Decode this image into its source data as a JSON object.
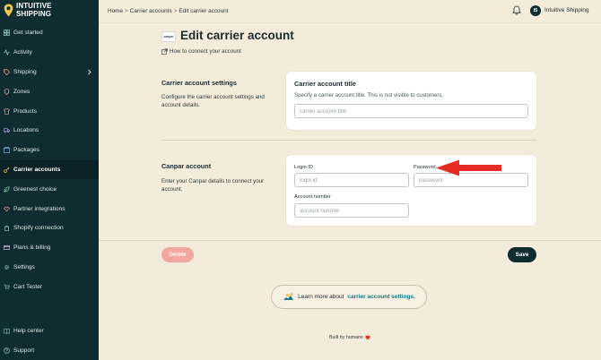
{
  "brand": {
    "line1": "INTUITIVE",
    "line2": "SHIPPING",
    "accent": "#f2c84b"
  },
  "sidebar": {
    "items": [
      {
        "label": "Get started",
        "icon": "grid-icon"
      },
      {
        "label": "Activity",
        "icon": "activity-icon"
      },
      {
        "label": "Shipping",
        "icon": "tag-icon",
        "has_chevron": true
      },
      {
        "label": "Zones",
        "icon": "pin-icon"
      },
      {
        "label": "Products",
        "icon": "shirt-icon"
      },
      {
        "label": "Locations",
        "icon": "truck-icon"
      },
      {
        "label": "Packages",
        "icon": "box-icon"
      },
      {
        "label": "Carrier accounts",
        "icon": "key-icon",
        "active": true
      },
      {
        "label": "Greenest choice",
        "icon": "leaf-icon"
      },
      {
        "label": "Partner integrations",
        "icon": "handshake-icon"
      },
      {
        "label": "Shopify connection",
        "icon": "shopify-icon"
      },
      {
        "label": "Plans & billing",
        "icon": "card-icon"
      },
      {
        "label": "Settings",
        "icon": "gear-icon"
      },
      {
        "label": "Cart Tester",
        "icon": "cart-icon"
      }
    ],
    "bottom": [
      {
        "label": "Help center",
        "icon": "book-icon"
      },
      {
        "label": "Support",
        "icon": "question-icon"
      }
    ]
  },
  "topbar": {
    "breadcrumb": [
      "Home",
      "Carrier accounts",
      "Edit carrier account"
    ],
    "separator": ">",
    "avatar_initials": "IS",
    "user_name": "Intuitive Shipping"
  },
  "page": {
    "carrier_logo_text": "canpar",
    "title": "Edit carrier account",
    "howto_link": "How to connect your account"
  },
  "settings_section": {
    "title": "Carrier account settings",
    "description": "Configure the carrier account settings and account details.",
    "card_title": "Carrier account title",
    "card_subtitle": "Specify a carrier account title. This is not visible to customers.",
    "title_placeholder": "carrier account title"
  },
  "canpar_section": {
    "title": "Canpar account",
    "description": "Enter your Canpar details to connect your account.",
    "login_label": "Login ID",
    "login_placeholder": "login id",
    "password_label": "Password",
    "password_placeholder": "password",
    "account_label": "Account number",
    "account_placeholder": "account number"
  },
  "actions": {
    "delete_label": "Delete",
    "save_label": "Save"
  },
  "learn_more": {
    "text": "Learn more about",
    "link": "carrier account settings."
  },
  "footer": {
    "built_by": "Built by humans"
  },
  "colors": {
    "sidebar_bg": "#0f2c31",
    "page_bg": "#f4ecdb",
    "delete_bg": "#f2a7a0",
    "link": "#137a86",
    "arrow": "#e52b22"
  }
}
